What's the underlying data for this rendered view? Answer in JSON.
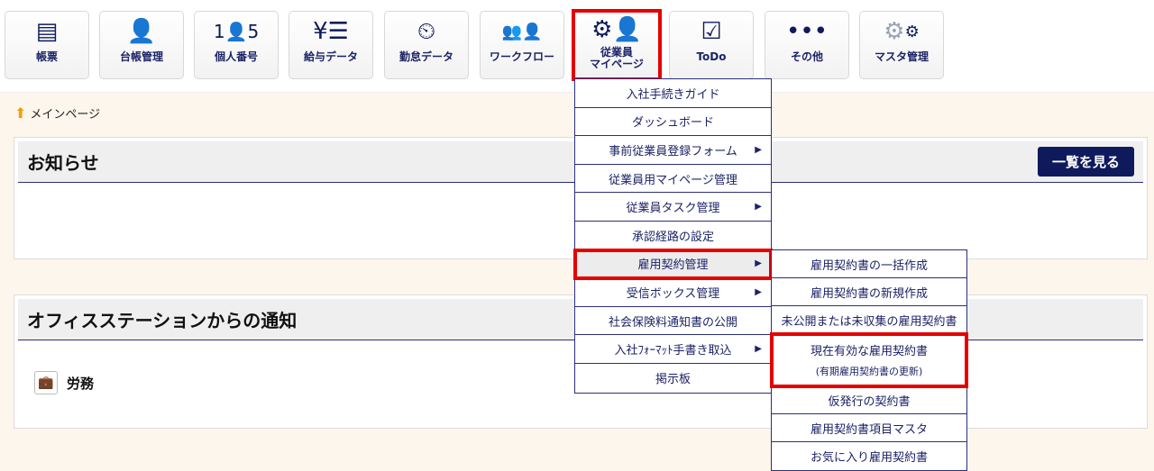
{
  "toolbar": [
    {
      "label": "帳票",
      "icon": "document-icon"
    },
    {
      "label": "台帳管理",
      "icon": "id-card-icon"
    },
    {
      "label": "個人番号",
      "icon": "person-number-icon"
    },
    {
      "label": "給与データ",
      "icon": "payroll-icon"
    },
    {
      "label": "勤怠データ",
      "icon": "clock-icon"
    },
    {
      "label": "ワークフロー",
      "icon": "workflow-icon"
    },
    {
      "label": "従業員",
      "label2": "マイページ",
      "icon": "employee-icon"
    },
    {
      "label": "ToDo",
      "icon": "todo-icon"
    },
    {
      "label": "その他",
      "icon": "more-icon"
    },
    {
      "label": "マスタ管理",
      "icon": "gear-icon"
    }
  ],
  "breadcrumb": "メインページ",
  "notice": {
    "title": "お知らせ",
    "button": "一覧を見る"
  },
  "office": {
    "title": "オフィスステーションからの通知",
    "item": "労務"
  },
  "menu": [
    "入社手続きガイド",
    "ダッシュボード",
    "事前従業員登録フォーム",
    "従業員用マイページ管理",
    "従業員タスク管理",
    "承認経路の設定",
    "雇用契約管理",
    "受信ボックス管理",
    "社会保険料通知書の公開",
    "入社ﾌｫｰﾏｯﾄ手書き取込",
    "掲示板"
  ],
  "submenu": [
    "雇用契約書の一括作成",
    "雇用契約書の新規作成",
    "未公開または未収集の雇用契約書",
    "現在有効な雇用契約書",
    "(有期雇用契約書の更新)",
    "仮発行の契約書",
    "雇用契約書項目マスタ",
    "お気に入り雇用契約書"
  ]
}
